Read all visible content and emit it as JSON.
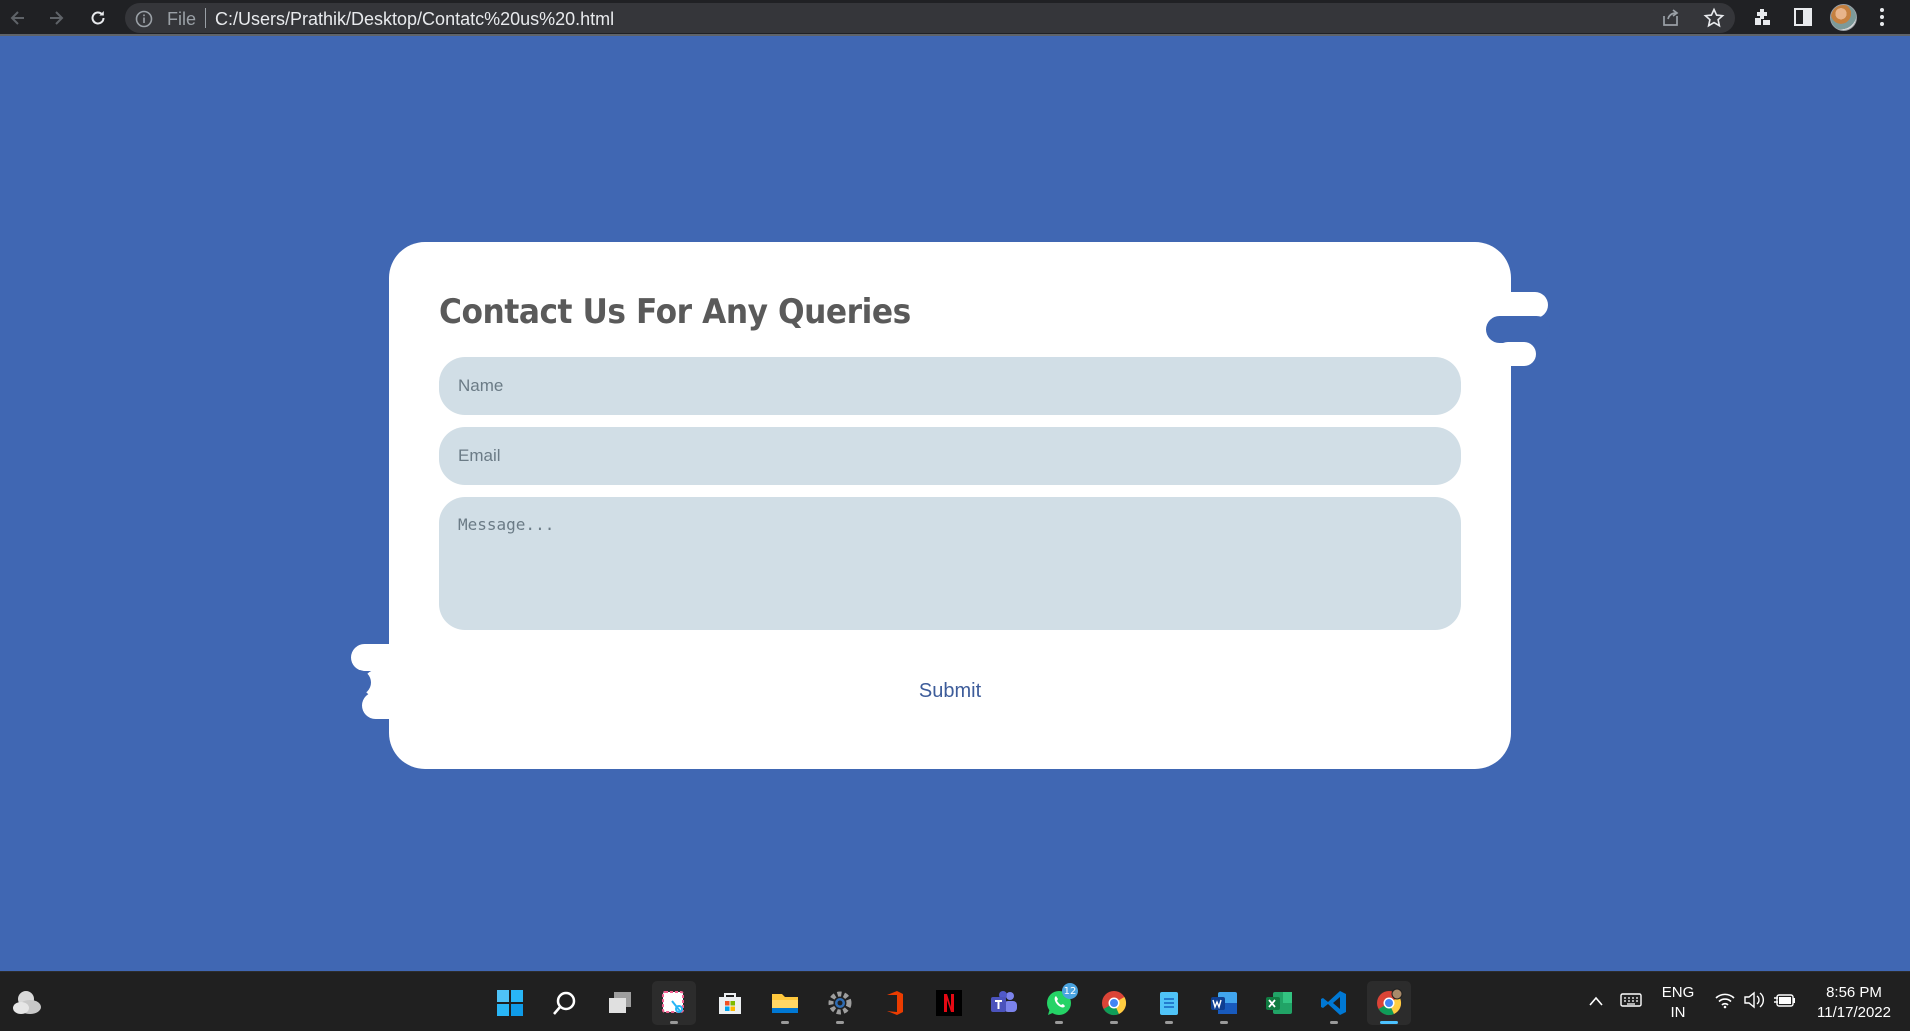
{
  "browser": {
    "scheme_label": "File",
    "url": "C:/Users/Prathik/Desktop/Contatc%20us%20.html",
    "icons": [
      "back-arrow-icon",
      "forward-arrow-icon",
      "reload-icon",
      "info-icon",
      "share-icon",
      "star-icon",
      "extensions-icon",
      "side-panel-icon",
      "profile-avatar",
      "menu-icon"
    ]
  },
  "contact_form": {
    "title": "Contact Us For Any Queries",
    "name_placeholder": "Name",
    "email_placeholder": "Email",
    "message_placeholder": "Message...",
    "submit_label": "Submit"
  },
  "taskbar": {
    "whatsapp_badge": "12",
    "language_top": "ENG",
    "language_bottom": "IN",
    "time": "8:56 PM",
    "date": "11/17/2022",
    "apps": [
      "start",
      "search",
      "task-view",
      "snipping-tool",
      "microsoft-store",
      "file-explorer",
      "settings",
      "office",
      "netflix",
      "teams",
      "whatsapp",
      "chrome",
      "notepad",
      "word",
      "excel",
      "vscode",
      "chrome-profile"
    ]
  },
  "colors": {
    "page_background": "#4067b3",
    "card": "#ffffff",
    "field": "#d1dee6",
    "title_text": "#5a5a5a",
    "submit_text": "#3d5c9a"
  }
}
